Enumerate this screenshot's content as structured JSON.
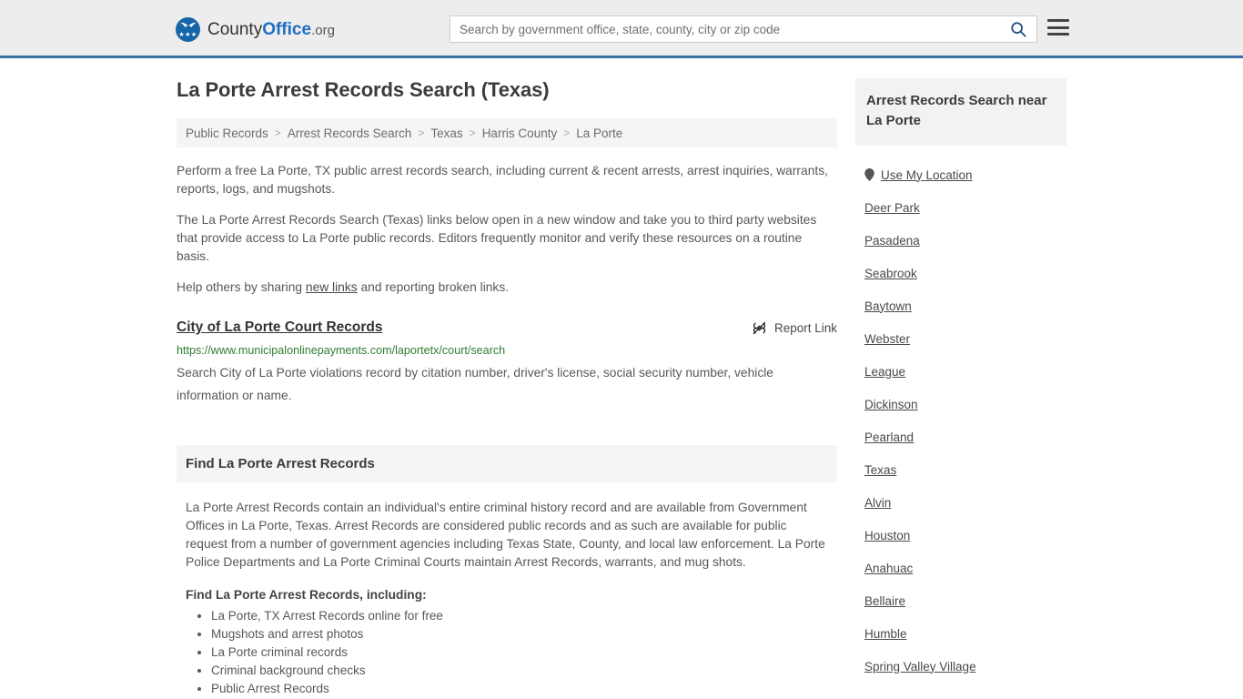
{
  "header": {
    "brand": {
      "part1": "County",
      "part2": "Office",
      "part3": ".org"
    },
    "search": {
      "placeholder": "Search by government office, state, county, city or zip code",
      "value": ""
    },
    "icons": {
      "search": "search-icon",
      "menu": "hamburger-menu-icon"
    }
  },
  "main": {
    "title": "La Porte Arrest Records Search (Texas)",
    "breadcrumb": [
      "Public Records",
      "Arrest Records Search",
      "Texas",
      "Harris County",
      "La Porte"
    ],
    "breadcrumb_separator": ">",
    "paragraphs": {
      "intro": "Perform a free La Porte, TX public arrest records search, including current & recent arrests, arrest inquiries, warrants, reports, logs, and mugshots.",
      "disclaimer": "The La Porte Arrest Records Search (Texas) links below open in a new window and take you to third party websites that provide access to La Porte public records. Editors frequently monitor and verify these resources on a routine basis.",
      "share_prefix": "Help others by sharing ",
      "share_link": "new links",
      "share_suffix": " and reporting broken links."
    },
    "result": {
      "title": "City of La Porte Court Records",
      "url": "https://www.municipalonlinepayments.com/laportetx/court/search",
      "description": "Search City of La Porte violations record by citation number, driver's license, social security number, vehicle information or name.",
      "report_label": "Report Link",
      "report_icon": "broken-link-icon"
    },
    "section": {
      "heading": "Find La Porte Arrest Records",
      "body": "La Porte Arrest Records contain an individual's entire criminal history record and are available from Government Offices in La Porte, Texas. Arrest Records are considered public records and as such are available for public request from a number of government agencies including Texas State, County, and local law enforcement. La Porte Police Departments and La Porte Criminal Courts maintain Arrest Records, warrants, and mug shots.",
      "sub_heading": "Find La Porte Arrest Records, including:",
      "items": [
        "La Porte, TX Arrest Records online for free",
        "Mugshots and arrest photos",
        "La Porte criminal records",
        "Criminal background checks",
        "Public Arrest Records"
      ]
    }
  },
  "sidebar": {
    "heading": "Arrest Records Search near La Porte",
    "use_my_location": "Use My Location",
    "location_icon": "map-pin-icon",
    "cities": [
      "Deer Park",
      "Pasadena",
      "Seabrook",
      "Baytown",
      "Webster",
      "League",
      "Dickinson",
      "Pearland",
      "Texas",
      "Alvin",
      "Houston",
      "Anahuac",
      "Bellaire",
      "Humble",
      "Spring Valley Village"
    ]
  },
  "colors": {
    "header_bg": "#ededed",
    "header_border": "#3a72a8",
    "brand_blue": "#1f6fc4",
    "url_green": "#2f7d32",
    "panel_gray": "#f5f5f5",
    "text": "#585858"
  }
}
